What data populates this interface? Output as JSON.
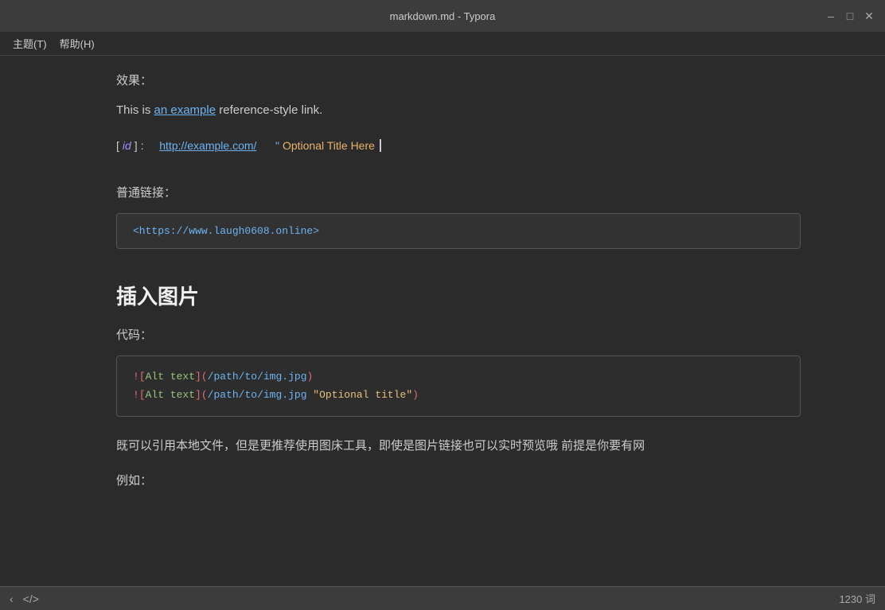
{
  "window": {
    "title": "markdown.md - Typora",
    "minimize": "–",
    "maximize": "□",
    "close": "✕"
  },
  "menu": {
    "theme": "主题(T)",
    "help": "帮助(H)"
  },
  "content": {
    "effect_label": "效果：",
    "effect_text_prefix": "This is ",
    "effect_link_text": "an example",
    "effect_text_suffix": " reference-style link.",
    "ref_open1": "[",
    "ref_id": " id ",
    "ref_close1": "]",
    "ref_colon": ":",
    "ref_url": "http://example.com/",
    "ref_quote": "\"",
    "ref_title": " Optional Title Here ",
    "normal_link_label": "普通链接：",
    "normal_link_url": "<https://www.laugh0608.online>",
    "insert_image_heading": "插入图片",
    "code_label": "代码：",
    "image_code_line1_excl": "!",
    "image_code_line1_open": "[",
    "image_code_line1_alt": "Alt text",
    "image_code_line1_close": "]",
    "image_code_line1_popen": "(",
    "image_code_line1_path": "/path/to/img.jpg",
    "image_code_line1_pclose": ")",
    "image_code_line2_excl": "!",
    "image_code_line2_open": "[",
    "image_code_line2_alt": "Alt text",
    "image_code_line2_close": "]",
    "image_code_line2_popen": "(",
    "image_code_line2_path": "/path/to/img.jpg",
    "image_code_line2_string": " \"Optional title\"",
    "image_code_line2_pclose": ")",
    "desc_text": "既可以引用本地文件，但是更推荐使用图床工具，即使是图片链接也可以实时预览哦 前提是你要有网",
    "example_label": "例如："
  },
  "status_bar": {
    "word_count": "1230 词",
    "icon_code": "</>",
    "icon_arrow_left": "‹",
    "icon_arrow_right": "›"
  }
}
